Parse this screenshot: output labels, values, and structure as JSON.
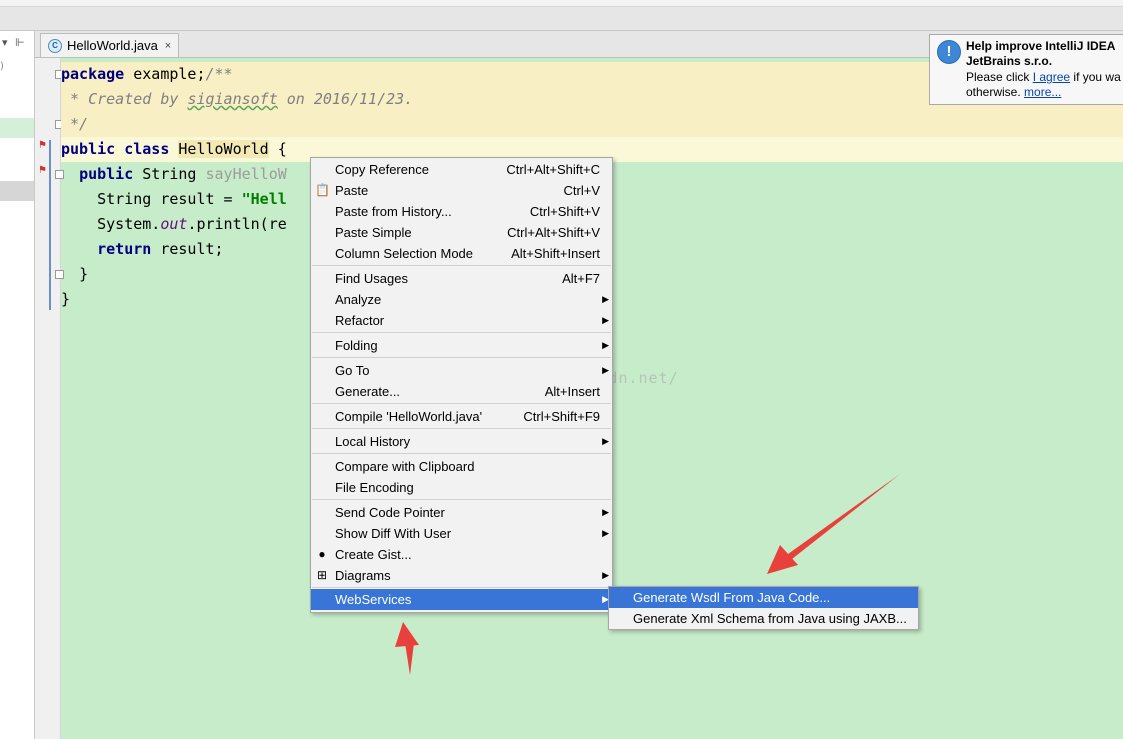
{
  "tab": {
    "label": "HelloWorld.java",
    "icon": "java-class-icon",
    "close": "×"
  },
  "left_panel": {
    "mark": ")"
  },
  "code": {
    "l1_kw": "package",
    "l1_rest": " example;",
    "l1_cm": "/**",
    "l2_pre": " * Created by ",
    "l2_name": "sigiansoft",
    "l2_post": " on 2016/11/23.",
    "l3": " */",
    "l4_kw1": "public",
    "l4_kw2": "class",
    "l4_cls": "HelloWorld",
    "l4_rest": " {",
    "l5_kw": "public",
    "l5_type": " String ",
    "l5_method": "sayHelloW",
    "l6_pre": "String result = ",
    "l6_str": "\"Hell",
    "l7_pre": "System.",
    "l7_fld": "out",
    "l7_rest": ".println(re",
    "l8_kw": "return",
    "l8_rest": " result;",
    "l9": "}",
    "l10": "}"
  },
  "watermark": "http://blog.csdn.net/",
  "notification": {
    "title": "Help improve IntelliJ IDEA",
    "company": "JetBrains s.r.o.",
    "text_pre": "Please click ",
    "agree": "I agree",
    "text_post": " if you wa",
    "text2_pre": "otherwise. ",
    "more": "more..."
  },
  "context_menu": {
    "copy_reference": {
      "label": "Copy Reference",
      "shortcut": "Ctrl+Alt+Shift+C"
    },
    "paste": {
      "label": "Paste",
      "shortcut": "Ctrl+V"
    },
    "paste_history": {
      "label": "Paste from History...",
      "shortcut": "Ctrl+Shift+V"
    },
    "paste_simple": {
      "label": "Paste Simple",
      "shortcut": "Ctrl+Alt+Shift+V"
    },
    "column_mode": {
      "label": "Column Selection Mode",
      "shortcut": "Alt+Shift+Insert"
    },
    "find_usages": {
      "label": "Find Usages",
      "shortcut": "Alt+F7"
    },
    "analyze": {
      "label": "Analyze"
    },
    "refactor": {
      "label": "Refactor"
    },
    "folding": {
      "label": "Folding"
    },
    "go_to": {
      "label": "Go To"
    },
    "generate": {
      "label": "Generate...",
      "shortcut": "Alt+Insert"
    },
    "compile": {
      "label": "Compile 'HelloWorld.java'",
      "shortcut": "Ctrl+Shift+F9"
    },
    "local_history": {
      "label": "Local History"
    },
    "compare_clipboard": {
      "label": "Compare with Clipboard"
    },
    "file_encoding": {
      "label": "File Encoding"
    },
    "send_code_pointer": {
      "label": "Send Code Pointer"
    },
    "show_diff": {
      "label": "Show Diff With User"
    },
    "create_gist": {
      "label": "Create Gist..."
    },
    "diagrams": {
      "label": "Diagrams"
    },
    "webservices": {
      "label": "WebServices"
    },
    "arrow": "▶"
  },
  "submenu": {
    "gen_wsdl": "Generate Wsdl From Java Code...",
    "gen_xml": "Generate Xml Schema from Java using JAXB..."
  },
  "colors": {
    "selection": "#3875d7",
    "annotation_arrow": "#e8403a"
  }
}
